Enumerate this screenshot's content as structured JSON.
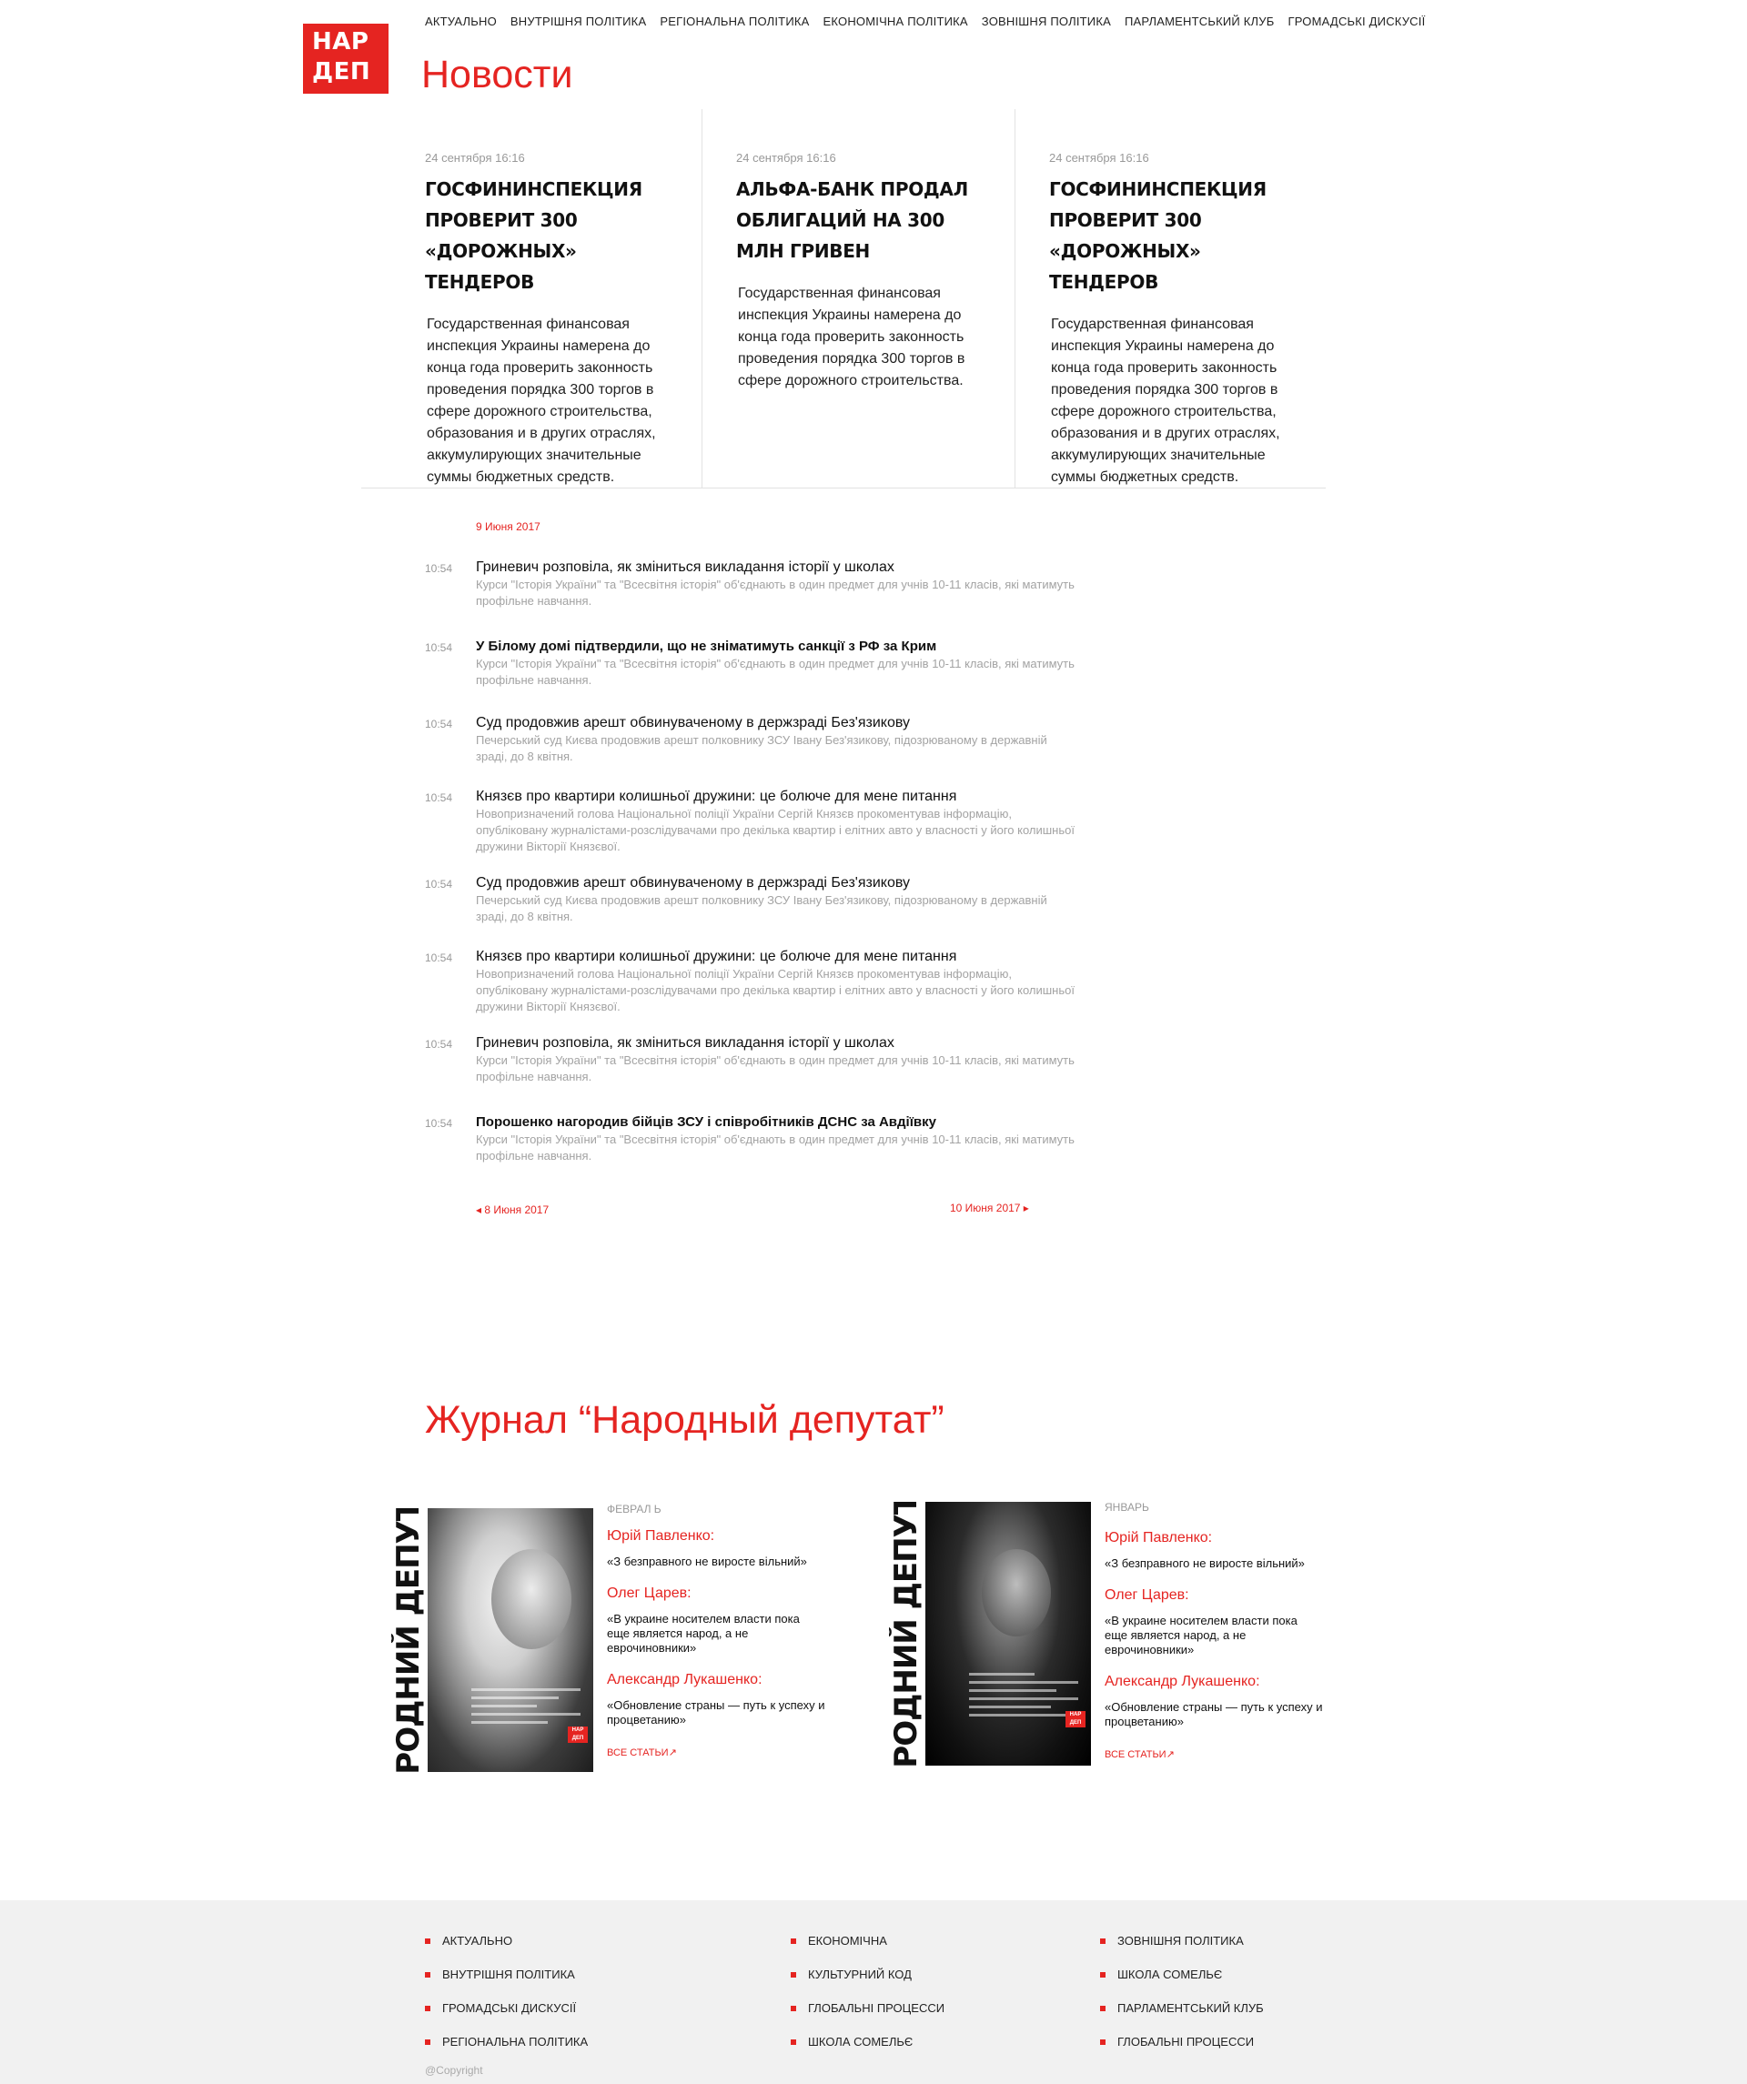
{
  "logo": {
    "line1": "НАР",
    "line2": "ДЕП"
  },
  "nav": [
    "Актуально",
    "Внутрішня політика",
    "Регіональна політика",
    "Економічна політика",
    "Зовнішня політика",
    "Парламентський клуб",
    "Громадські дискусії"
  ],
  "page_title": "Новости",
  "featured": [
    {
      "date": "24 сентября 16:16",
      "title": "Госфининспекция проверит 300 «дорожных» тендеров",
      "text": "Государственная финансовая инспекция Украины намерена до конца года проверить законность проведения порядка 300 торгов в сфере дорожного строительства, образования и в других отраслях, аккумулирующих значительные суммы бюджетных средств."
    },
    {
      "date": "24 сентября 16:16",
      "title": "Альфа-банк продал облигаций на 300 млн гривен",
      "text": "Государственная финансовая инспекция Украины намерена до конца года проверить законность проведения порядка 300 торгов в сфере дорожного строительства."
    },
    {
      "date": "24 сентября 16:16",
      "title": "Госфининспекция проверит 300 «дорожных» тендеров",
      "text": "Государственная финансовая инспекция Украины намерена до конца года проверить законность проведения порядка 300 торгов в сфере дорожного строительства, образования и в других отраслях, аккумулирующих значительные суммы бюджетных средств."
    }
  ],
  "news_date": "9 Июня 2017",
  "news": [
    {
      "time": "10:54",
      "title": "Гриневич розповіла, як зміниться викладання історії у школах",
      "bold": false,
      "desc": "Курси \"Історія України\" та \"Всесвітня історія\" об'єднають в один предмет для учнів 10-11 класів, які матимуть профільне навчання."
    },
    {
      "time": "10:54",
      "title": "У Білому домі підтвердили, що не зніматимуть санкції з РФ за Крим",
      "bold": true,
      "desc": "Курси \"Історія України\" та \"Всесвітня історія\" об'єднають в один предмет для учнів 10-11 класів, які матимуть профільне навчання."
    },
    {
      "time": "10:54",
      "title": "Суд продовжив арешт обвинуваченому в держзраді Без'язикову",
      "bold": false,
      "desc": "Печерський суд Києва продовжив арешт полковнику ЗСУ Івану Без'язикову, підозрюваному в державній зраді, до 8 квітня."
    },
    {
      "time": "10:54",
      "title": "Князєв про квартири колишньої дружини: це болюче для мене питання",
      "bold": false,
      "desc": "Новопризначений голова Національної поліції України Сергій Князєв прокоментував інформацію, опубліковану журналістами-розслідувачами про декілька квартир і елітних авто у власності у його колишньої дружини Вікторії Князєвої."
    },
    {
      "time": "10:54",
      "title": "Суд продовжив арешт обвинуваченому в держзраді Без'язикову",
      "bold": false,
      "desc": "Печерський суд Києва продовжив арешт полковнику ЗСУ Івану Без'язикову, підозрюваному в державній зраді, до 8 квітня."
    },
    {
      "time": "10:54",
      "title": "Князєв про квартири колишньої дружини: це болюче для мене питання",
      "bold": false,
      "desc": "Новопризначений голова Національної поліції України Сергій Князєв прокоментував інформацію, опубліковану журналістами-розслідувачами про декілька квартир і елітних авто у власності у його колишньої дружини Вікторії Князєвої."
    },
    {
      "time": "10:54",
      "title": "Гриневич розповіла, як зміниться викладання історії у школах",
      "bold": false,
      "desc": "Курси \"Історія України\" та \"Всесвітня історія\" об'єднають в один предмет для учнів 10-11 класів, які матимуть профільне навчання."
    },
    {
      "time": "10:54",
      "title": "Порошенко нагородив бійців ЗСУ і співробітників ДСНС за Авдіївку",
      "bold": true,
      "desc": "Курси \"Історія України\" та \"Всесвітня історія\" об'єднають в один предмет для учнів 10-11 класів, які матимуть профільне навчання."
    }
  ],
  "pager": {
    "prev": "◂  8 Июня 2017",
    "next": "10 Июня 2017 ▸"
  },
  "journal_title": "Журнал “Народный депутат”",
  "issues": [
    {
      "month": "Феврал ь",
      "cover_masthead": "НАРОДНИЙ ДЕПУТАТ",
      "items": [
        {
          "author": "Юрій Павленко:",
          "quote": "«З безправного не виросте вільний»"
        },
        {
          "author": "Олег Царев:",
          "quote": "«В украине носителем власти пока еще является народ, а не еврочиновники»"
        },
        {
          "author": "Александр Лукашенко:",
          "quote": "«Обновление страны — путь к успеху и процветанию»"
        }
      ],
      "all_link": "Все статьи"
    },
    {
      "month": "Январь",
      "cover_masthead": "НАРОДНИЙ ДЕПУТАТ",
      "items": [
        {
          "author": "Юрій Павленко:",
          "quote": "«З безправного не виросте вільний»"
        },
        {
          "author": "Олег Царев:",
          "quote": "«В украине носителем власти пока еще является народ, а не еврочиновники»"
        },
        {
          "author": "Александр Лукашенко:",
          "quote": "«Обновление страны — путь к успеху и процветанию»"
        }
      ],
      "all_link": "Все статьи"
    }
  ],
  "footer": {
    "col1": [
      "Актуально",
      "Внутрішня політика",
      "Громадські дискусії",
      "Регіональна політика"
    ],
    "col2": [
      "Економічна",
      "Культурний код",
      "Глобальні процесси",
      "Школа сомельє"
    ],
    "col3": [
      "Зовнішня політика",
      "Школа сомельє",
      "Парламентський клуб",
      "Глобальні процесси"
    ],
    "copyright": "@Copyright"
  },
  "colors": {
    "accent": "#e52421",
    "muted": "#999999",
    "footer_bg": "#f1f1f1"
  }
}
